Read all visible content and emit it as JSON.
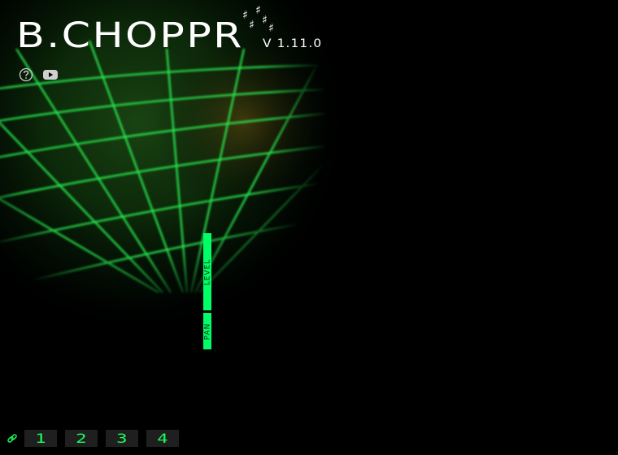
{
  "app": {
    "title": "B.CHOPPR",
    "version": "V 1.11.0"
  },
  "toolbar": {
    "help_icon": "help-circle-icon",
    "video_icon": "youtube-icon"
  },
  "sliders": {
    "level_label": "LEVEL",
    "pan_label": "PAN"
  },
  "bottom": {
    "link_icon": "link-icon",
    "pages": [
      "1",
      "2",
      "3",
      "4"
    ]
  },
  "colors": {
    "accent": "#00ff66",
    "grid": "#22ff55",
    "background": "#000000",
    "page_button_bg": "#1f1f1f",
    "page_button_text": "#19ff5c"
  }
}
